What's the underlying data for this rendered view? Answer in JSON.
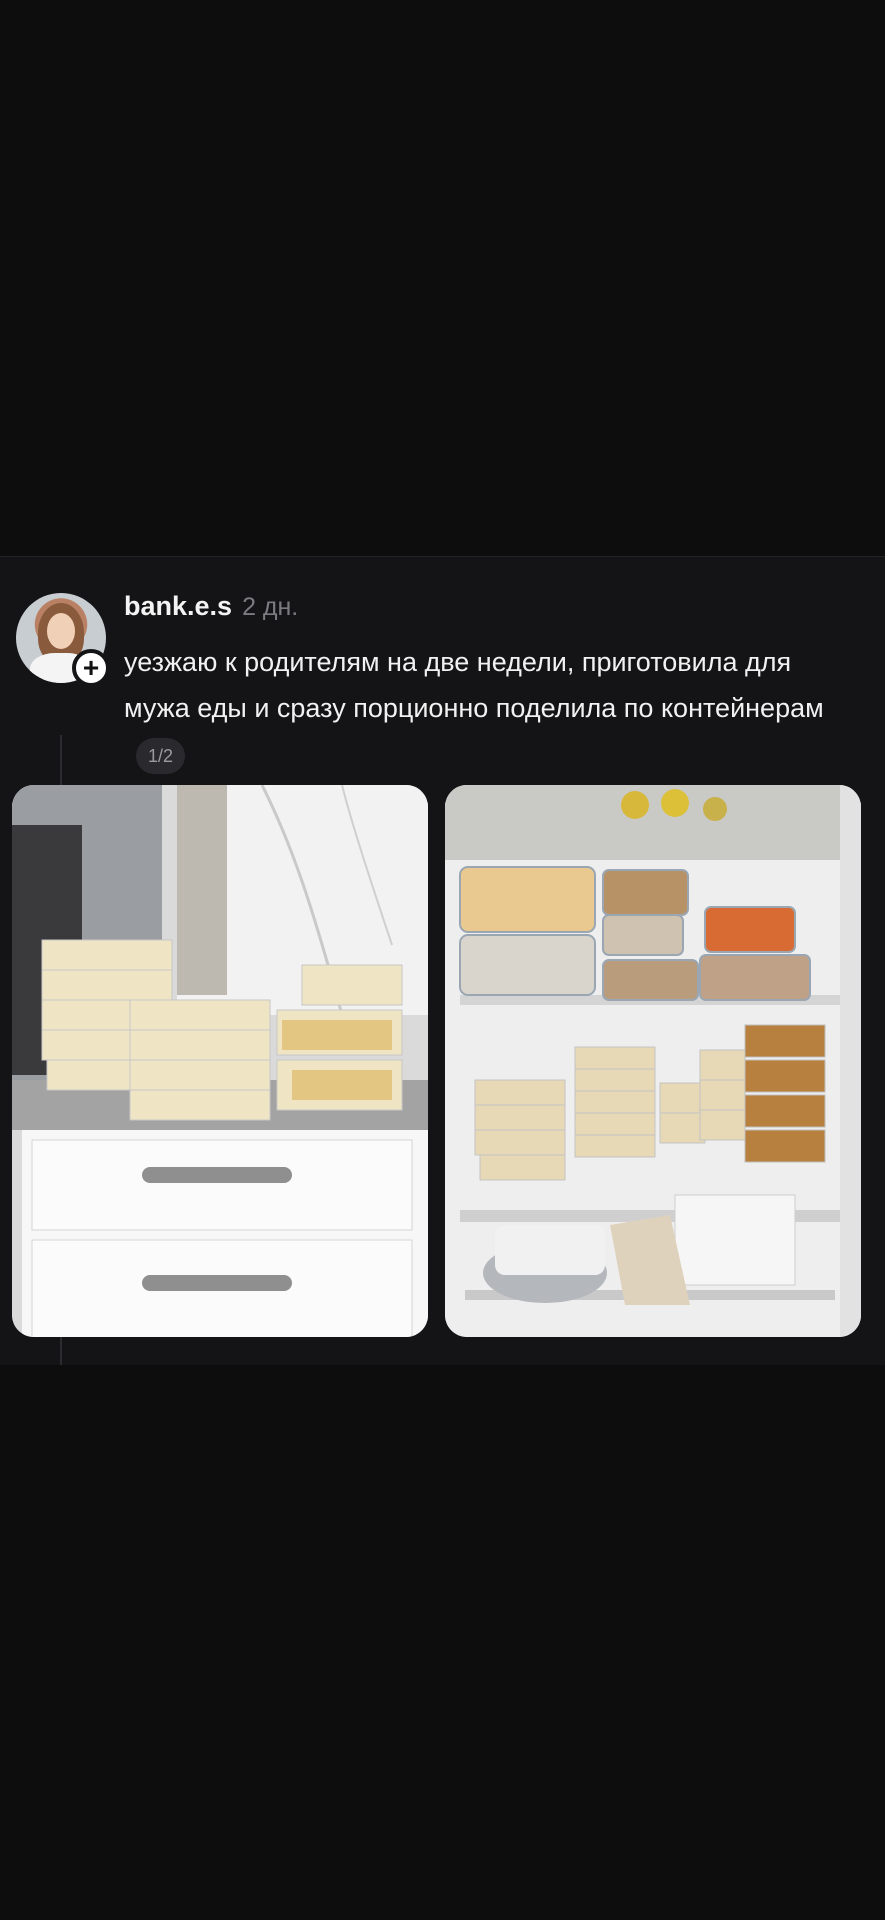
{
  "post": {
    "username": "bank.e.s",
    "time": "2 дн.",
    "text": "уезжаю к родителям на две недели, приготовила для мужа еды и сразу порционно поделила по контейнерам",
    "counter": "1/2",
    "follow_symbol": "+"
  },
  "icons": {
    "follow": "plus-icon"
  },
  "colors": {
    "background": "#0d0d0e",
    "post_background": "#141416",
    "text": "#f1f1f1",
    "muted": "#7b7b80"
  }
}
